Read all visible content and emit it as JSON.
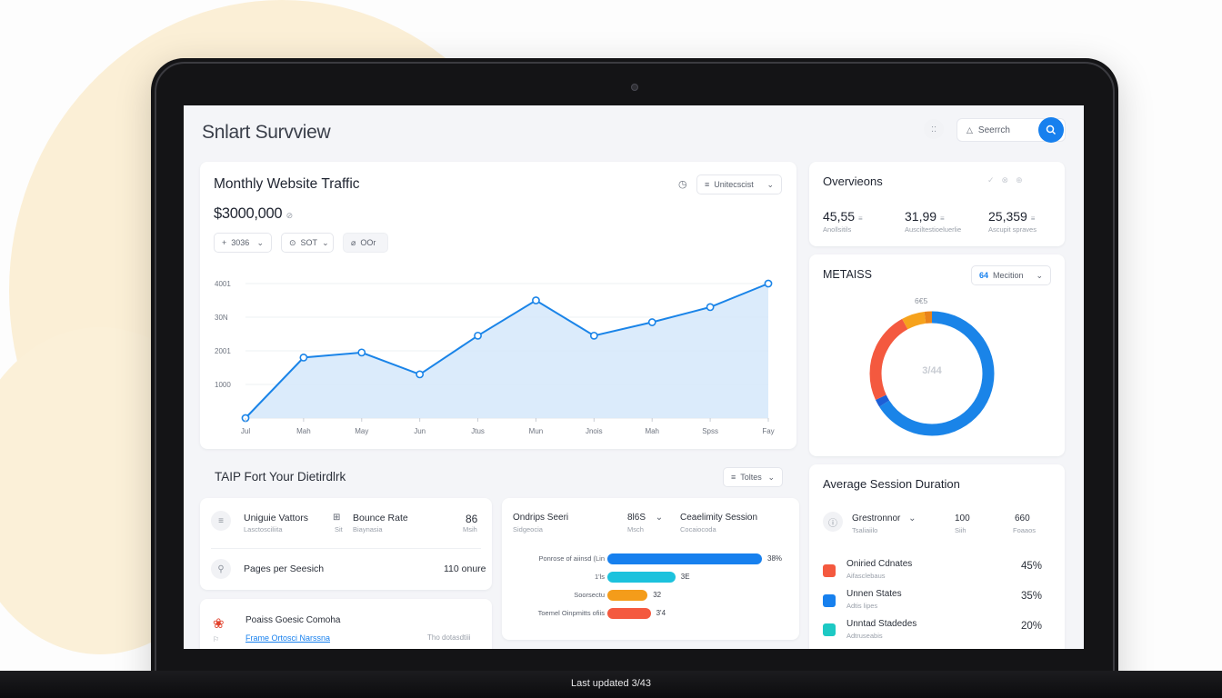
{
  "app": {
    "title": "Snlart Survview",
    "footer": "Last updated 3/43"
  },
  "header": {
    "search_placeholder": "Seerrch",
    "icon_btn": "::"
  },
  "traffic": {
    "title": "Monthly Website Traffic",
    "total": "$3000,000",
    "total_suffix": "⊘",
    "dropdown": "Unitecscist",
    "filters": [
      "3036",
      "SOT",
      "OOr"
    ],
    "filter_icons": [
      "+",
      "⊙",
      "⌀"
    ]
  },
  "chart_data": {
    "type": "area",
    "x": [
      "Jul",
      "Mah",
      "May",
      "Jun",
      "Jtus",
      "Mun",
      "Jnois",
      "Mah",
      "Spss",
      "Fay"
    ],
    "values": [
      0,
      1800,
      1950,
      1300,
      2450,
      3500,
      2450,
      2850,
      3300,
      4000
    ],
    "ylim": [
      0,
      4000
    ],
    "yticks": [
      "4001",
      "30N",
      "2001",
      "1000"
    ],
    "color": "#1a84e8",
    "fill": "#d7e9fb"
  },
  "overview": {
    "title": "Overvieons",
    "tools": [
      "✓",
      "⊗",
      "⊕"
    ],
    "stats": [
      {
        "value": "45,55",
        "unit": "≡",
        "label": "Anollsitils"
      },
      {
        "value": "31,99",
        "unit": "≡",
        "label": "Ausciltestioeluerlie"
      },
      {
        "value": "25,359",
        "unit": "≡",
        "label": "Ascupit spraves"
      }
    ]
  },
  "metrics": {
    "title": "METAISS",
    "dropdown_value": "64",
    "dropdown_label": "Mecition",
    "donut_top": "6€5",
    "donut_center": "3/44",
    "segments": [
      {
        "value": 66,
        "color": "#1a84e8"
      },
      {
        "value": 2,
        "color": "#1d5fd6"
      },
      {
        "value": 24,
        "color": "#f4593f"
      },
      {
        "value": 6,
        "color": "#f6a21c"
      },
      {
        "value": 2,
        "color": "#e9831a"
      }
    ]
  },
  "distribution": {
    "title": "TAIP Fort Your Dietirdlrk",
    "dropdown": "Toltes"
  },
  "visitors": {
    "unique": {
      "label": "Uniguie Vattors",
      "sub": "Lasctosciliita",
      "side_label": "Sit",
      "side_icon": "⊞"
    },
    "bounce": {
      "label": "Bounce Rate",
      "sub": "Biaynasia",
      "value": "86",
      "value_sub": "Msih"
    },
    "pages": {
      "label": "Pages per Seesich",
      "value": "110 onure"
    }
  },
  "country": {
    "label": "Poaiss Goesic Comoha",
    "link": "Frame Ortosci Narssna",
    "right": "Tho dotasdtiii"
  },
  "sessions": {
    "col1": {
      "label": "Ondrips Seeri",
      "sub": "Sidgeocia"
    },
    "col2": {
      "label": "8l6S",
      "sub": "Msch"
    },
    "col3": {
      "label": "Ceaelimity Session",
      "sub": "Cocaiocoda"
    },
    "bars": [
      {
        "label": "Ponrose of aiinsd (Lin",
        "value": 100,
        "value_label": "38%",
        "color": "#1780ee"
      },
      {
        "label": "1'ls",
        "value": 44,
        "value_label": "3E",
        "color": "#1cc2dd"
      },
      {
        "label": "Soorsectu",
        "value": 26,
        "value_label": "32",
        "color": "#f49c1a"
      },
      {
        "label": "Toemel Oinpmitts ofiis",
        "value": 28,
        "value_label": "3'4",
        "color": "#f4593f"
      }
    ]
  },
  "avg_session": {
    "title": "Average Session Duration",
    "head": {
      "label": "Grestronnor",
      "sub": "Tsaliaiilo",
      "c1": "100",
      "c1_sub": "Siih",
      "c2": "660",
      "c2_sub": "Foaaos"
    },
    "rows": [
      {
        "label": "Oniried Cdnates",
        "sub": "Aifasclebaus",
        "value": "45%",
        "color": "#f4593f"
      },
      {
        "label": "Unnen States",
        "sub": "Adtis lipes",
        "value": "35%",
        "color": "#1780ee"
      },
      {
        "label": "Unntad Stadedes",
        "sub": "Adtruseabis",
        "value": "20%",
        "color": "#1dc9c4"
      }
    ]
  }
}
